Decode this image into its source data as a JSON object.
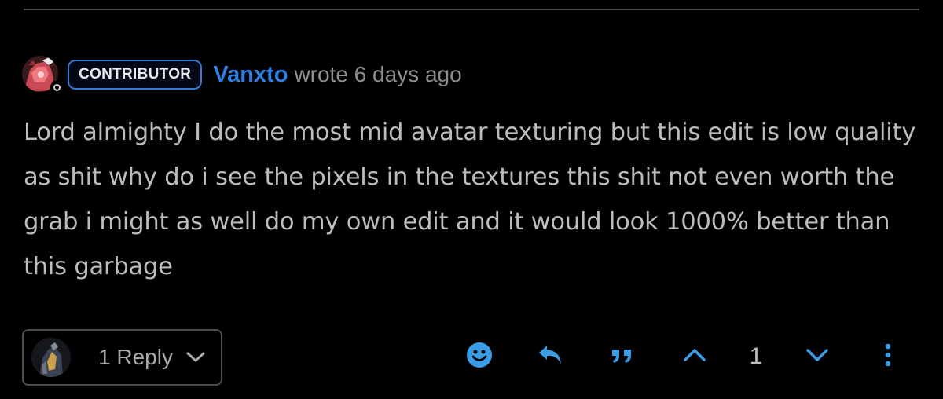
{
  "comment": {
    "badge": "CONTRIBUTOR",
    "author": "Vanxto",
    "meta": "wrote 6 days ago",
    "body": "Lord almighty I do the most mid avatar texturing but this edit is low quality as shit why do i see the pixels in the textures this shit not even worth the grab i might as well do my own edit and it would look 1000% better than this garbage"
  },
  "replies": {
    "label": "1 Reply"
  },
  "actions": {
    "vote_count": "1",
    "icons": [
      "emoji-icon",
      "reply-icon",
      "quote-icon",
      "upvote-icon",
      "downvote-icon",
      "more-icon"
    ]
  },
  "colors": {
    "background": "#000000",
    "accent": "#2d7fe3",
    "icon": "#3a9be6",
    "text": "#bcbcbc",
    "muted": "#8f8f8f",
    "border": "#4c4c4c"
  }
}
